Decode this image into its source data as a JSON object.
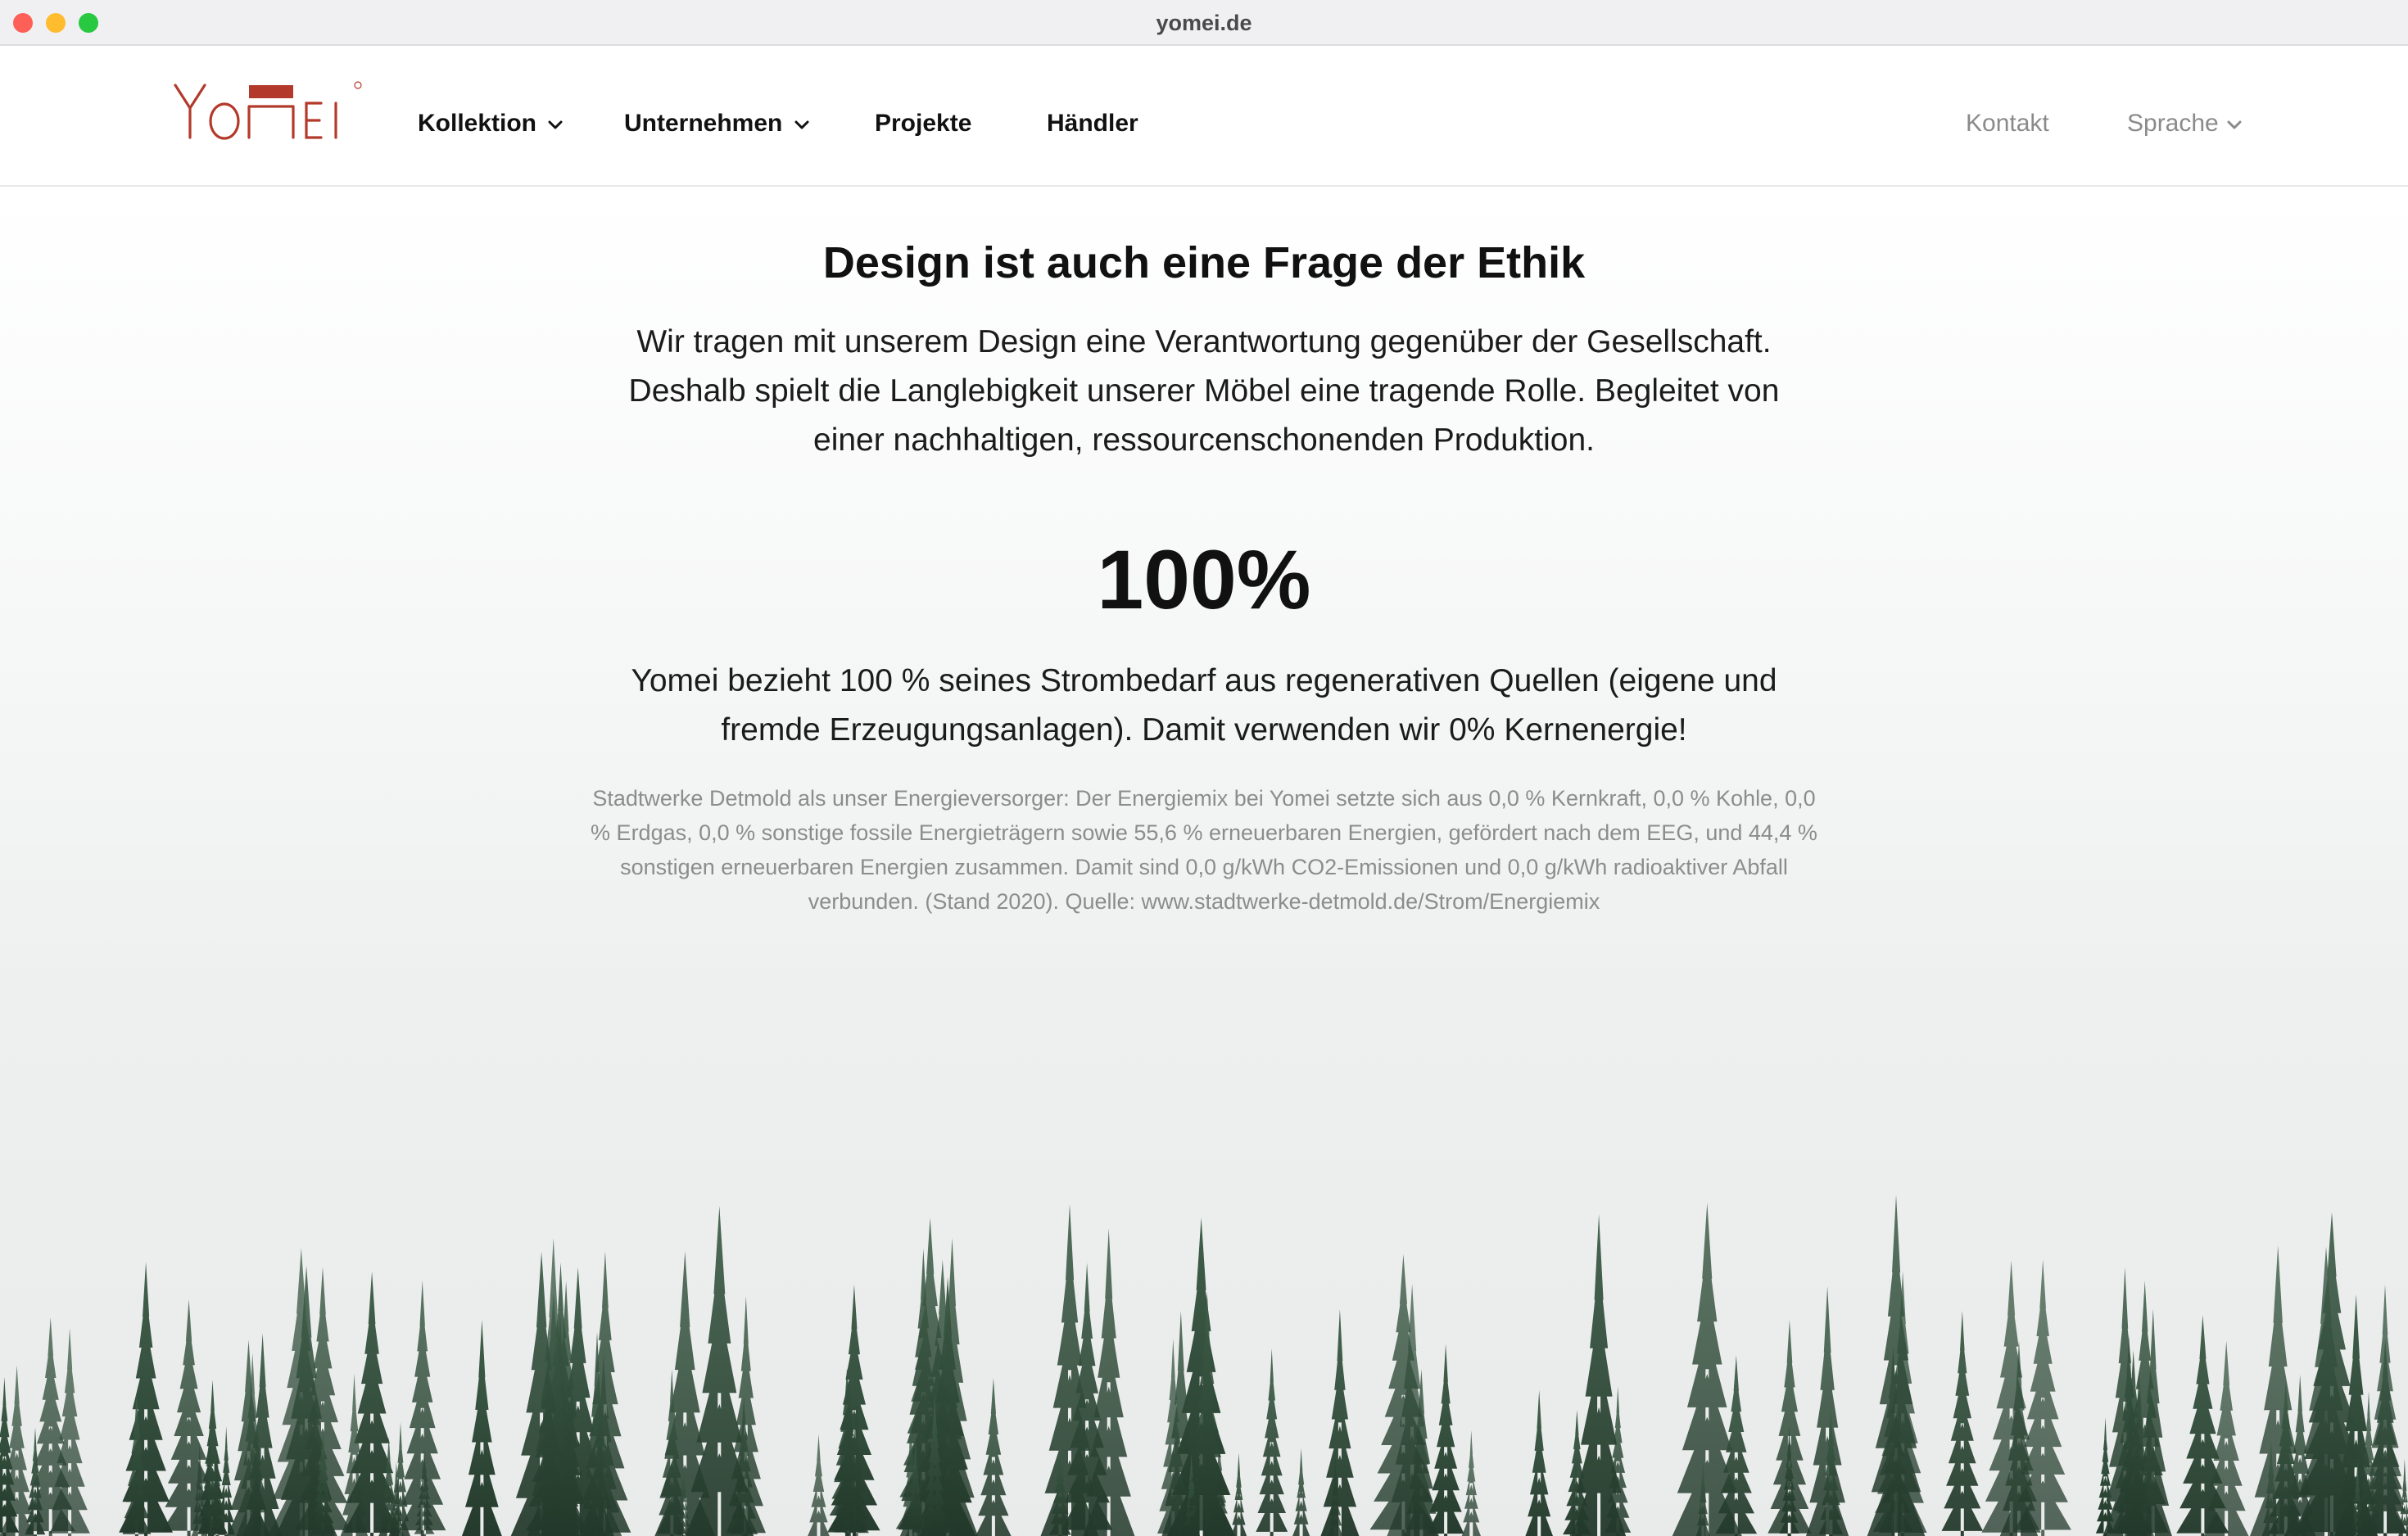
{
  "window": {
    "title": "yomei.de"
  },
  "header": {
    "logo_text": "YOMEI",
    "logo_color": "#b33a2a",
    "nav": [
      {
        "label": "Kollektion",
        "has_dropdown": true
      },
      {
        "label": "Unternehmen",
        "has_dropdown": true
      },
      {
        "label": "Projekte",
        "has_dropdown": false
      },
      {
        "label": "Händler",
        "has_dropdown": false
      }
    ],
    "contact_label": "Kontakt",
    "language_label": "Sprache"
  },
  "main": {
    "headline": "Design ist auch eine Frage der Ethik",
    "intro": "Wir tragen mit unserem Design eine Verantwortung gegenüber der Gesellschaft. Deshalb spielt die Langlebigkeit unserer Möbel eine tragende Rolle. Begleitet von einer nachhaltigen, ressourcenschonenden Produktion.",
    "stat_value": "100%",
    "claim": "Yomei bezieht 100 % seines Strombedarf aus regenerativen Quellen (eigene und fremde Erzeugungsanlagen). Damit verwenden wir 0% Kernenergie!",
    "fineprint": "Stadtwerke Detmold als unser Energieversorger: Der Energiemix bei Yomei setzte sich aus 0,0 % Kernkraft, 0,0 % Kohle, 0,0 % Erdgas, 0,0 % sonstige fossile Energieträgern sowie 55,6 % erneuerbaren Energien, gefördert nach dem EEG, und 44,4 % sonstigen erneuerbaren Energien zusammen. Damit sind 0,0 g/kWh CO2-Emissionen und 0,0 g/kWh radioaktiver Abfall verbunden. (Stand 2020). Quelle: www.stadtwerke-detmold.de/Strom/Energiemix"
  },
  "icons": {
    "dropdown": "chevron-down-icon"
  }
}
